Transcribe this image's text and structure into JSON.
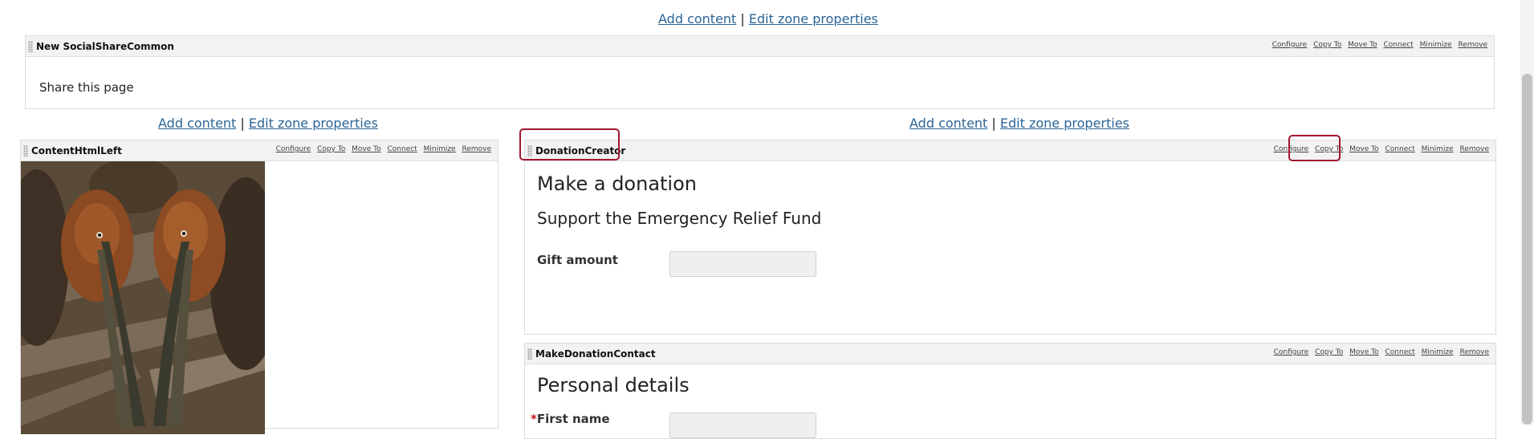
{
  "top_zone": {
    "add_content": "Add content",
    "separator": "|",
    "edit_zone": "Edit zone properties",
    "webpart": {
      "title": "New SocialShareCommon",
      "body_text": "Share this page"
    }
  },
  "actions": {
    "configure": "Configure",
    "copy_to": "Copy To",
    "move_to": "Move To",
    "connect": "Connect",
    "minimize": "Minimize",
    "remove": "Remove"
  },
  "left_zone": {
    "add_content": "Add content",
    "separator": "|",
    "edit_zone": "Edit zone properties",
    "webpart": {
      "title": "ContentHtmlLeft",
      "image_alt": "Brown pelicans"
    }
  },
  "right_zone": {
    "add_content": "Add content",
    "separator": "|",
    "edit_zone": "Edit zone properties",
    "donation_webpart": {
      "title": "DonationCreator",
      "heading": "Make a donation",
      "subheading": "Support the Emergency Relief Fund",
      "gift_label": "Gift amount",
      "gift_value": ""
    },
    "contact_webpart": {
      "title": "MakeDonationContact",
      "heading": "Personal details",
      "required_mark": "*",
      "first_name_label": "First name",
      "first_name_value": ""
    }
  },
  "colors": {
    "highlight": "#a3162e",
    "link": "#2a6496",
    "header_bg": "#f2f2f2"
  }
}
